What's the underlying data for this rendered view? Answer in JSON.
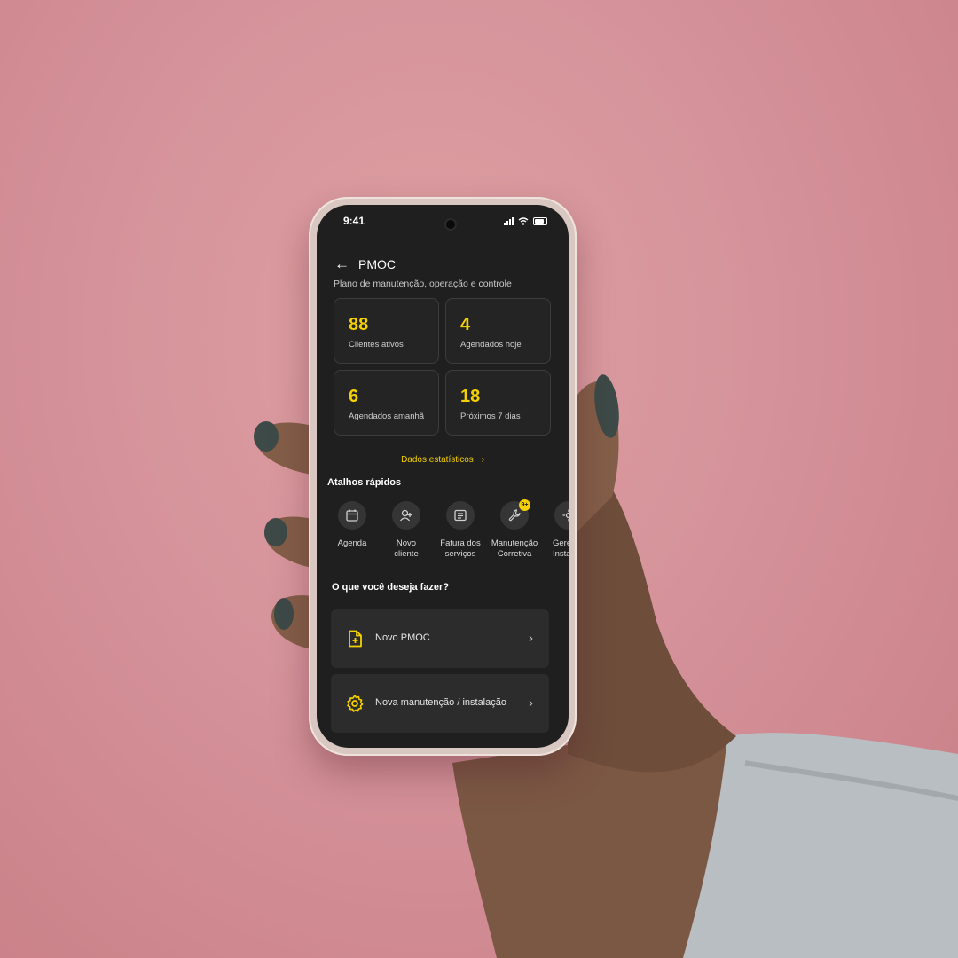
{
  "status_bar": {
    "time": "9:41"
  },
  "header": {
    "title": "PMOC",
    "subtitle": "Plano de manutenção, operação e controle"
  },
  "stats": [
    {
      "value": "88",
      "label": "Clientes ativos"
    },
    {
      "value": "4",
      "label": "Agendados hoje"
    },
    {
      "value": "6",
      "label": "Agendados amanhã"
    },
    {
      "value": "18",
      "label": "Próximos 7 dias"
    }
  ],
  "stats_link": {
    "label": "Dados estatísticos"
  },
  "shortcuts": {
    "title": "Atalhos rápidos",
    "items": [
      {
        "label": "Agenda",
        "icon": "calendar-icon"
      },
      {
        "label": "Novo\ncliente",
        "icon": "add-user-icon"
      },
      {
        "label": "Fatura dos\nserviços",
        "icon": "invoice-icon"
      },
      {
        "label": "Manutenção\nCorretiva",
        "icon": "wrench-icon",
        "badge": "9+"
      },
      {
        "label": "Gere\nInstal",
        "icon": "settings-icon"
      }
    ]
  },
  "actions": {
    "title": "O que você deseja fazer?",
    "items": [
      {
        "label": "Novo PMOC",
        "icon": "new-document-icon"
      },
      {
        "label": "Nova manutenção / instalação",
        "icon": "gear-icon"
      }
    ]
  },
  "colors": {
    "accent": "#f5d000",
    "screen_bg": "#1f1f1f",
    "card_bg": "#2c2c2c",
    "backdrop": "#d5929a"
  }
}
